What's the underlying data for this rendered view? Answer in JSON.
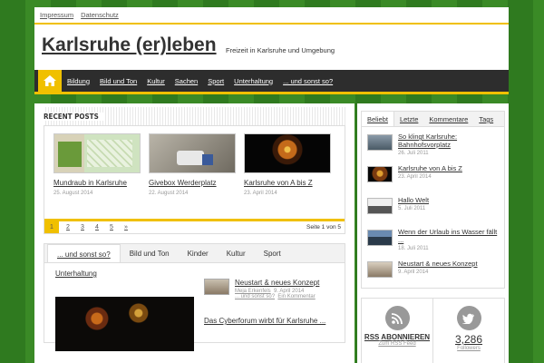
{
  "topbar": {
    "links": [
      "Impressum",
      "Datenschutz"
    ]
  },
  "header": {
    "title": "Karlsruhe (er)leben",
    "description": "Freizeit in Karlsruhe und Umgebung"
  },
  "nav": {
    "items": [
      "Bildung",
      "Bild und Ton",
      "Kultur",
      "Sachen",
      "Sport",
      "Unterhaltung",
      "... und sonst so?"
    ]
  },
  "recent": {
    "heading": "Recent Posts",
    "posts": [
      {
        "title": "Mundraub in Karlsruhe",
        "date": "25. August 2014"
      },
      {
        "title": "Givebox Werderplatz",
        "date": "22. August 2014"
      },
      {
        "title": "Karlsruhe von A bis Z",
        "date": "23. April 2014"
      }
    ],
    "pages": [
      "1",
      "2",
      "3",
      "4",
      "5",
      "»"
    ],
    "page_info": "Seite 1 von 5"
  },
  "tabs": {
    "items": [
      "... und sonst so?",
      "Bild und Ton",
      "Kinder",
      "Kultur",
      "Sport"
    ],
    "subtab": "Unterhaltung",
    "list": [
      {
        "title": "Neustart & neues Konzept",
        "author": "Meja Erkenfels",
        "date": "9. April 2014",
        "cat": "... und sonst so?",
        "comment": "Ein Kommentar"
      }
    ],
    "second_title": "Das Cyberforum wirbt für Karlsruhe ..."
  },
  "sidebar": {
    "tabs": [
      "Beliebt",
      "Letzte",
      "Kommentare",
      "Tags"
    ],
    "items": [
      {
        "title": "So klingt Karlsruhe: Bahnhofsvorplatz",
        "date": "26. Juli 2011"
      },
      {
        "title": "Karlsruhe von A bis Z",
        "date": "23. April 2014"
      },
      {
        "title": "Hallo Welt",
        "date": "5. Juli 2011"
      },
      {
        "title": "Wenn der Urlaub ins Wasser fällt ...",
        "date": "18. Juli 2011"
      },
      {
        "title": "Neustart & neues Konzept",
        "date": "9. April 2014"
      }
    ],
    "rss": {
      "label": "RSS Abonnieren",
      "sub": "Zum RSS Feed"
    },
    "twitter": {
      "count": "3,286",
      "sub": "Followers"
    }
  }
}
